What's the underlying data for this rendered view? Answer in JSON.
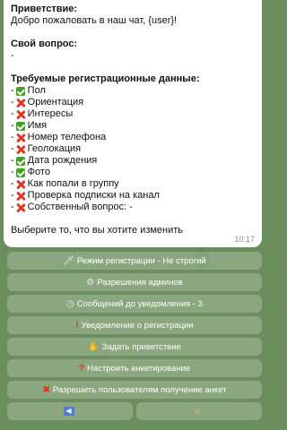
{
  "message": {
    "greeting_label": "Приветствие:",
    "greeting_text": "Добро пожаловать в наш чат, {user}!",
    "own_question_label": "Свой вопрос:",
    "own_question_value": "-",
    "required_label": "Требуемые регистрационные данные:",
    "fields": [
      {
        "prefix": "-",
        "status": "check",
        "label": "Пол"
      },
      {
        "prefix": "-",
        "status": "cross",
        "label": "Ориентация"
      },
      {
        "prefix": "-",
        "status": "cross",
        "label": "Интересы"
      },
      {
        "prefix": "-",
        "status": "check",
        "label": "Имя"
      },
      {
        "prefix": "-",
        "status": "cross",
        "label": "Номер телефона"
      },
      {
        "prefix": "-",
        "status": "cross",
        "label": "Геолокация"
      },
      {
        "prefix": "-",
        "status": "check",
        "label": "Дата рождения"
      },
      {
        "prefix": "-",
        "status": "check",
        "label": "Фото"
      },
      {
        "prefix": "-",
        "status": "cross",
        "label": "Как попали в группу"
      },
      {
        "prefix": "-",
        "status": "cross",
        "label": "Проверка подписки на канал"
      },
      {
        "prefix": "-",
        "status": "cross",
        "label": "Собственный вопрос: -"
      }
    ],
    "prompt": "Выберите то, что вы хотите изменить",
    "time": "10:17"
  },
  "keyboard": {
    "registration_mode": {
      "icon": "dagger-icon",
      "label": "Режим регистрации - Не строгий"
    },
    "admin_permissions": {
      "icon": "control-knobs-icon",
      "label": "Разрешения админов"
    },
    "messages_until_notify": {
      "icon": "clock-icon",
      "label": "Сообщений до уведомления - 3"
    },
    "registration_notice": {
      "icon": "exclamation-icon",
      "label": "Уведомление о регистрации"
    },
    "set_greeting": {
      "icon": "waving-hand-icon",
      "label": "Задать приветствие"
    },
    "configure_survey": {
      "icon": "question-icon",
      "label": "Настроить анкетирование"
    },
    "allow_users_profiles": {
      "icon": "cross-icon",
      "label": "Разрешить пользователям получение анкет"
    },
    "back": {
      "icon": "back-arrow-icon",
      "label": ""
    },
    "home": {
      "icon": "home-icon",
      "label": ""
    }
  }
}
